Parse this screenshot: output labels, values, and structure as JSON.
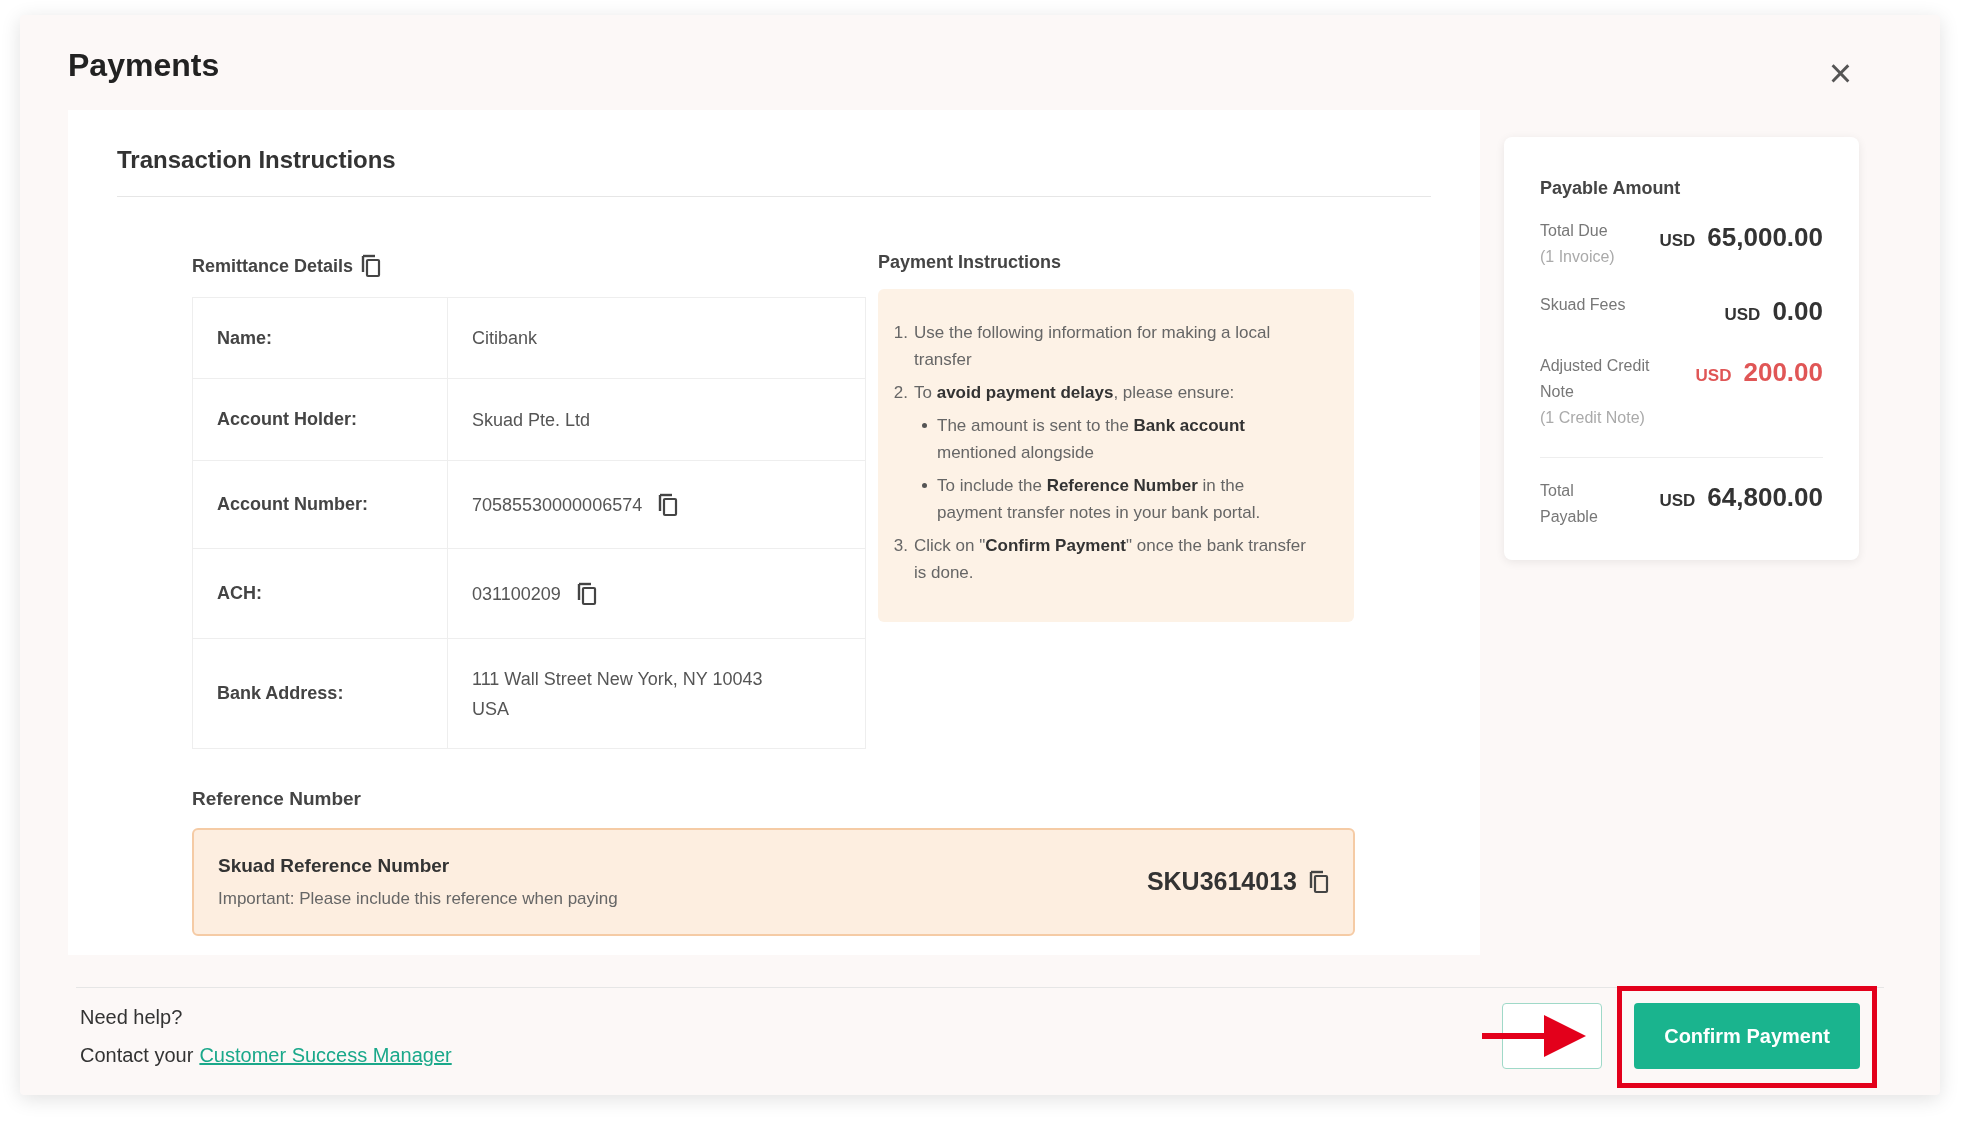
{
  "modal": {
    "title": "Payments",
    "close": "×"
  },
  "section_title": "Transaction Instructions",
  "remittance": {
    "title": "Remittance Details",
    "rows": [
      {
        "label": "Name:",
        "value": "Citibank",
        "copyable": false
      },
      {
        "label": "Account Holder:",
        "value": "Skuad Pte. Ltd",
        "copyable": false
      },
      {
        "label": "Account Number:",
        "value": "70585530000006574",
        "copyable": true
      },
      {
        "label": "ACH:",
        "value": "031100209",
        "copyable": true
      },
      {
        "label": "Bank Address:",
        "value": "111 Wall Street New York, NY 10043 USA",
        "copyable": false
      }
    ]
  },
  "payment_instructions": {
    "title": "Payment Instructions",
    "steps": [
      {
        "marker": "1.",
        "text": "Use the following information for making a local transfer"
      },
      {
        "marker": "2.",
        "text": "To **avoid payment delays**, please ensure:",
        "children": [
          {
            "text": "The amount is sent to the **Bank account** mentioned alongside"
          },
          {
            "text": "To include the **Reference Number** in the payment transfer notes in your bank portal."
          }
        ]
      },
      {
        "marker": "3.",
        "text": "Click on \"**Confirm Payment**\" once the bank transfer is done."
      }
    ]
  },
  "reference": {
    "title": "Reference Number",
    "label": "Skuad Reference Number",
    "note": "Important: Please include this reference when paying",
    "value": "SKU3614013"
  },
  "payable": {
    "title": "Payable Amount",
    "rows": [
      {
        "label": "Total Due",
        "sub": "(1 Invoice)",
        "currency": "USD",
        "amount": "65,000.00",
        "negative": false
      },
      {
        "label": "Skuad Fees",
        "currency": "USD",
        "amount": "0.00",
        "negative": false
      },
      {
        "label": "Adjusted Credit Note",
        "sub": "(1 Credit Note)",
        "currency": "USD",
        "amount": "200.00",
        "negative": true
      }
    ],
    "total": {
      "label": "Total Payable",
      "currency": "USD",
      "amount": "64,800.00"
    }
  },
  "footer": {
    "help": "Need help?",
    "contact": "Contact your",
    "link": "Customer Success Manager",
    "confirm": "Confirm Payment"
  }
}
